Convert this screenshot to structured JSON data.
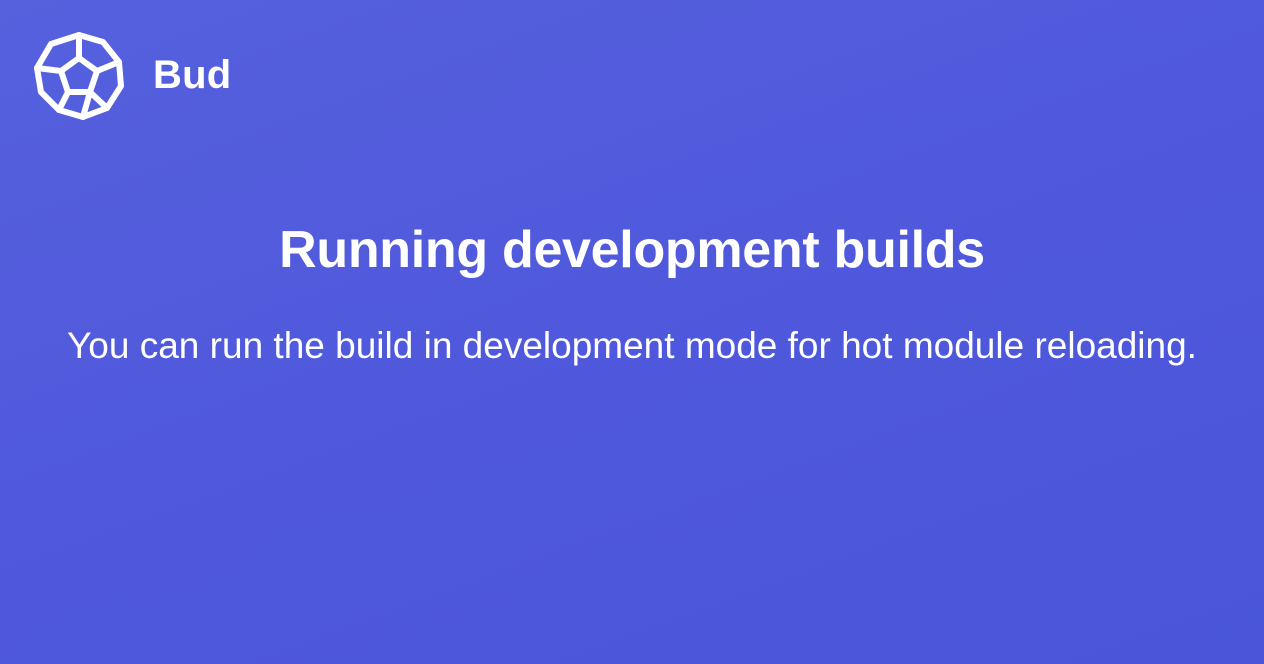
{
  "brand": {
    "logo_icon": "bud-polyhedron-logo-icon",
    "name": "Bud"
  },
  "content": {
    "title": "Running development builds",
    "description": "You can run the build in development mode for hot module reloading."
  },
  "colors": {
    "background_start": "#5561dd",
    "background_end": "#4a55d9",
    "text": "#ffffff"
  }
}
